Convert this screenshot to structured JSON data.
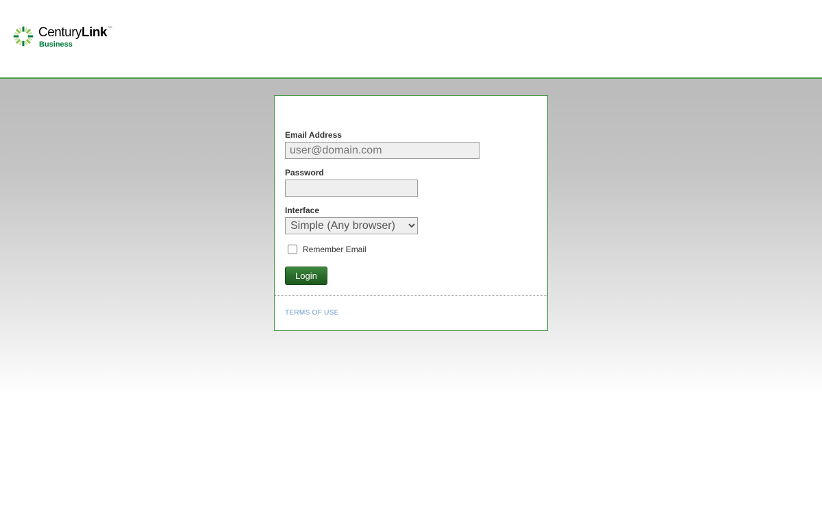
{
  "brand": {
    "name_part1": "Century",
    "name_part2": "Link",
    "tm": "™",
    "sub": "Business"
  },
  "form": {
    "email": {
      "label": "Email Address",
      "placeholder": "user@domain.com",
      "value": ""
    },
    "password": {
      "label": "Password",
      "value": ""
    },
    "interface": {
      "label": "Interface",
      "selected": "Simple (Any browser)"
    },
    "remember": {
      "label": "Remember Email"
    },
    "submit": {
      "label": "Login"
    }
  },
  "footer": {
    "terms_label": "TERMS OF USE"
  }
}
